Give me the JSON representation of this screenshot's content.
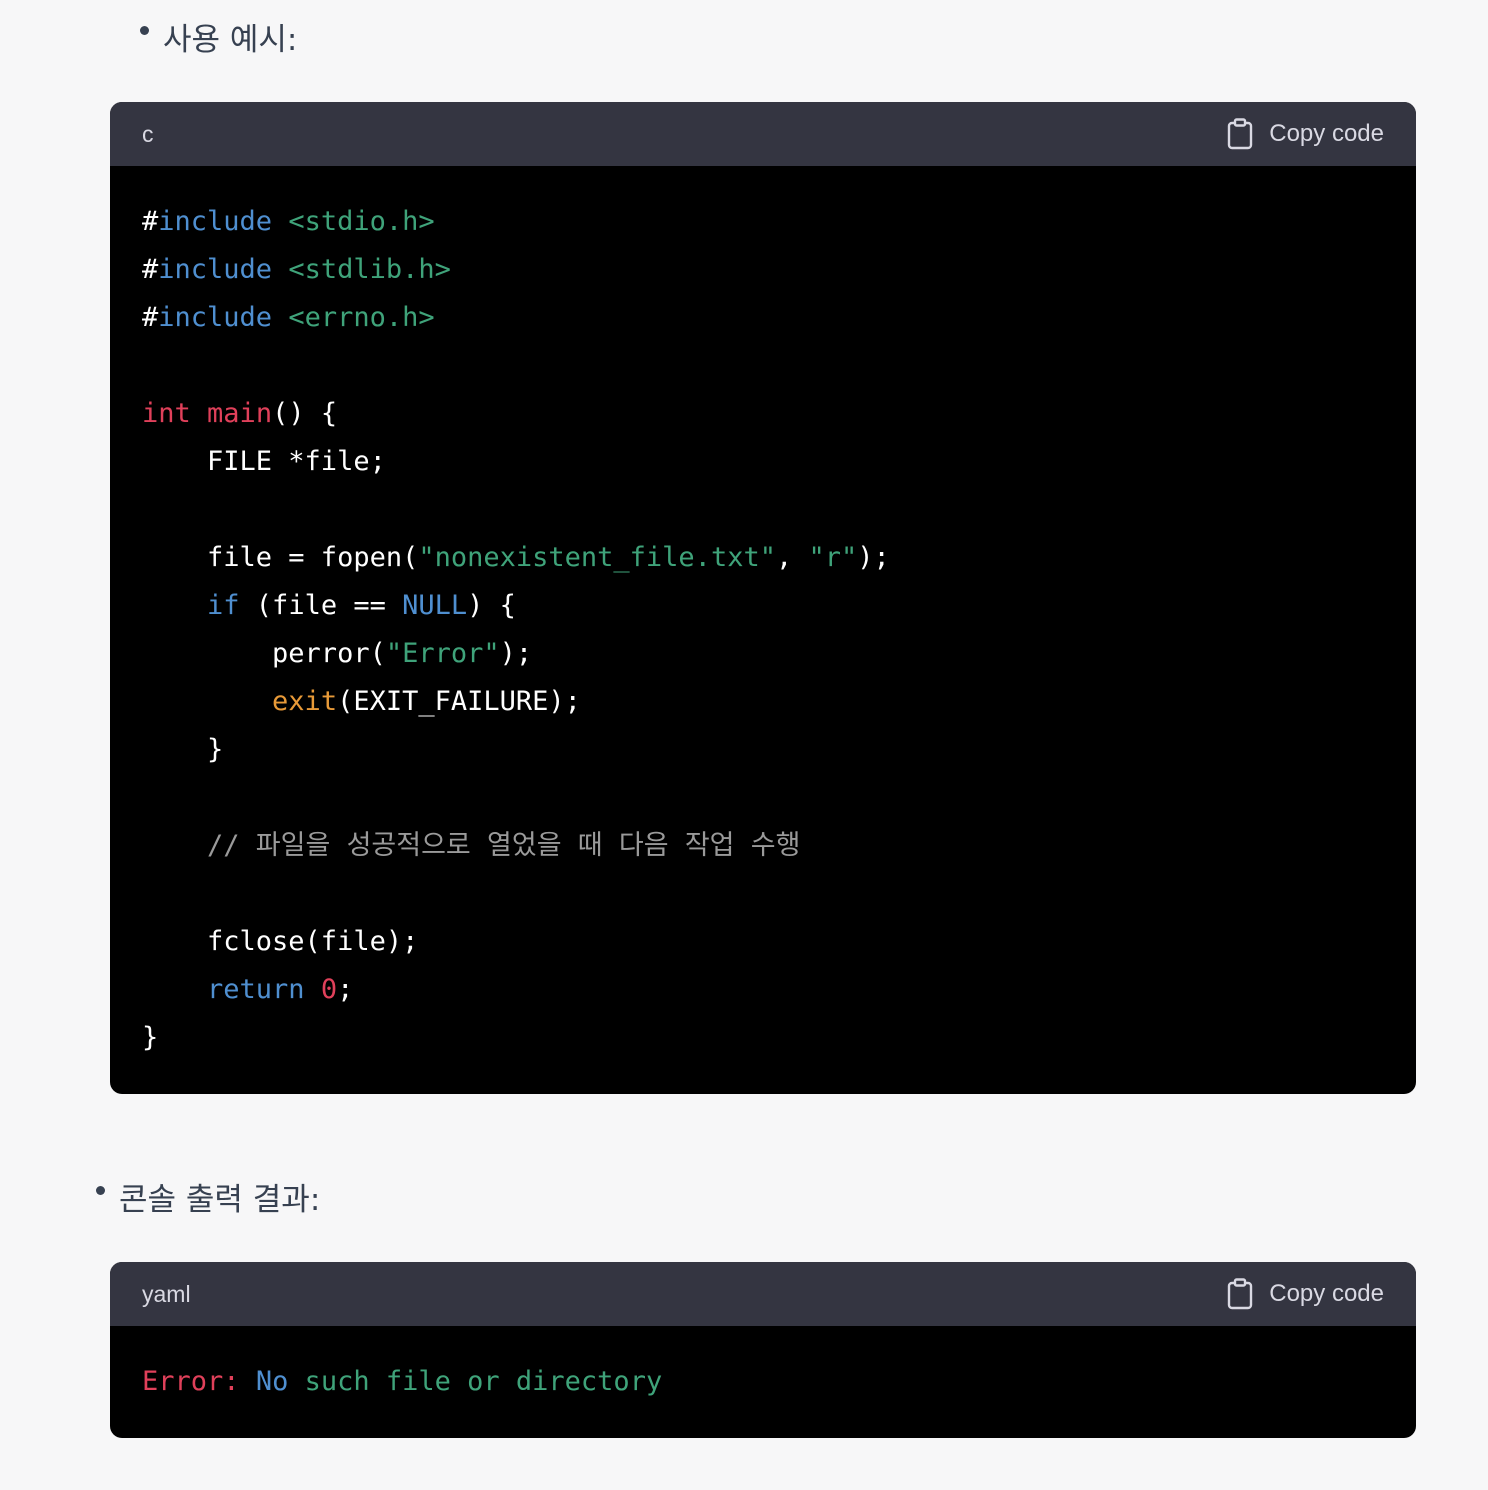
{
  "bullets": {
    "usage_example": "사용 예시:",
    "console_output": "콘솔 출력 결과:"
  },
  "blocks": [
    {
      "language": "c",
      "copy_label": "Copy code",
      "lines": [
        [
          {
            "t": "#",
            "c": "white"
          },
          {
            "t": "include",
            "c": "kw"
          },
          {
            "t": " ",
            "c": "white"
          },
          {
            "t": "<stdio.h>",
            "c": "str"
          }
        ],
        [
          {
            "t": "#",
            "c": "white"
          },
          {
            "t": "include",
            "c": "kw"
          },
          {
            "t": " ",
            "c": "white"
          },
          {
            "t": "<stdlib.h>",
            "c": "str"
          }
        ],
        [
          {
            "t": "#",
            "c": "white"
          },
          {
            "t": "include",
            "c": "kw"
          },
          {
            "t": " ",
            "c": "white"
          },
          {
            "t": "<errno.h>",
            "c": "str"
          }
        ],
        [],
        [
          {
            "t": "int",
            "c": "red"
          },
          {
            "t": " ",
            "c": "white"
          },
          {
            "t": "main",
            "c": "red"
          },
          {
            "t": "() {",
            "c": "white"
          }
        ],
        [
          {
            "t": "    FILE *file;",
            "c": "white"
          }
        ],
        [],
        [
          {
            "t": "    file = fopen(",
            "c": "white"
          },
          {
            "t": "\"nonexistent_file.txt\"",
            "c": "str"
          },
          {
            "t": ", ",
            "c": "white"
          },
          {
            "t": "\"r\"",
            "c": "str"
          },
          {
            "t": ");",
            "c": "white"
          }
        ],
        [
          {
            "t": "    ",
            "c": "white"
          },
          {
            "t": "if",
            "c": "kw"
          },
          {
            "t": " (file == ",
            "c": "white"
          },
          {
            "t": "NULL",
            "c": "kw"
          },
          {
            "t": ") {",
            "c": "white"
          }
        ],
        [
          {
            "t": "        perror(",
            "c": "white"
          },
          {
            "t": "\"Error\"",
            "c": "str"
          },
          {
            "t": ");",
            "c": "white"
          }
        ],
        [
          {
            "t": "        ",
            "c": "white"
          },
          {
            "t": "exit",
            "c": "fn"
          },
          {
            "t": "(EXIT_FAILURE);",
            "c": "white"
          }
        ],
        [
          {
            "t": "    }",
            "c": "white"
          }
        ],
        [],
        [
          {
            "t": "    // 파일을 성공적으로 열었을 때 다음 작업 수행",
            "c": "com"
          }
        ],
        [],
        [
          {
            "t": "    fclose(file);",
            "c": "white"
          }
        ],
        [
          {
            "t": "    ",
            "c": "white"
          },
          {
            "t": "return",
            "c": "kw"
          },
          {
            "t": " ",
            "c": "white"
          },
          {
            "t": "0",
            "c": "num"
          },
          {
            "t": ";",
            "c": "white"
          }
        ],
        [
          {
            "t": "}",
            "c": "white"
          }
        ]
      ]
    },
    {
      "language": "yaml",
      "copy_label": "Copy code",
      "lines": [
        [
          {
            "t": "Error:",
            "c": "red"
          },
          {
            "t": " ",
            "c": "white"
          },
          {
            "t": "No",
            "c": "kw"
          },
          {
            "t": " such file or directory",
            "c": "str"
          }
        ]
      ]
    }
  ],
  "colors": {
    "page_bg": "#f7f7f8",
    "header_bg": "#343541",
    "code_bg": "#000000",
    "keyword": "#4f8fd0",
    "string": "#3fa37a",
    "type_red": "#e0405a",
    "function": "#e89a38",
    "comment": "#9a9a9a"
  },
  "icons": {
    "copy": "clipboard-icon"
  }
}
